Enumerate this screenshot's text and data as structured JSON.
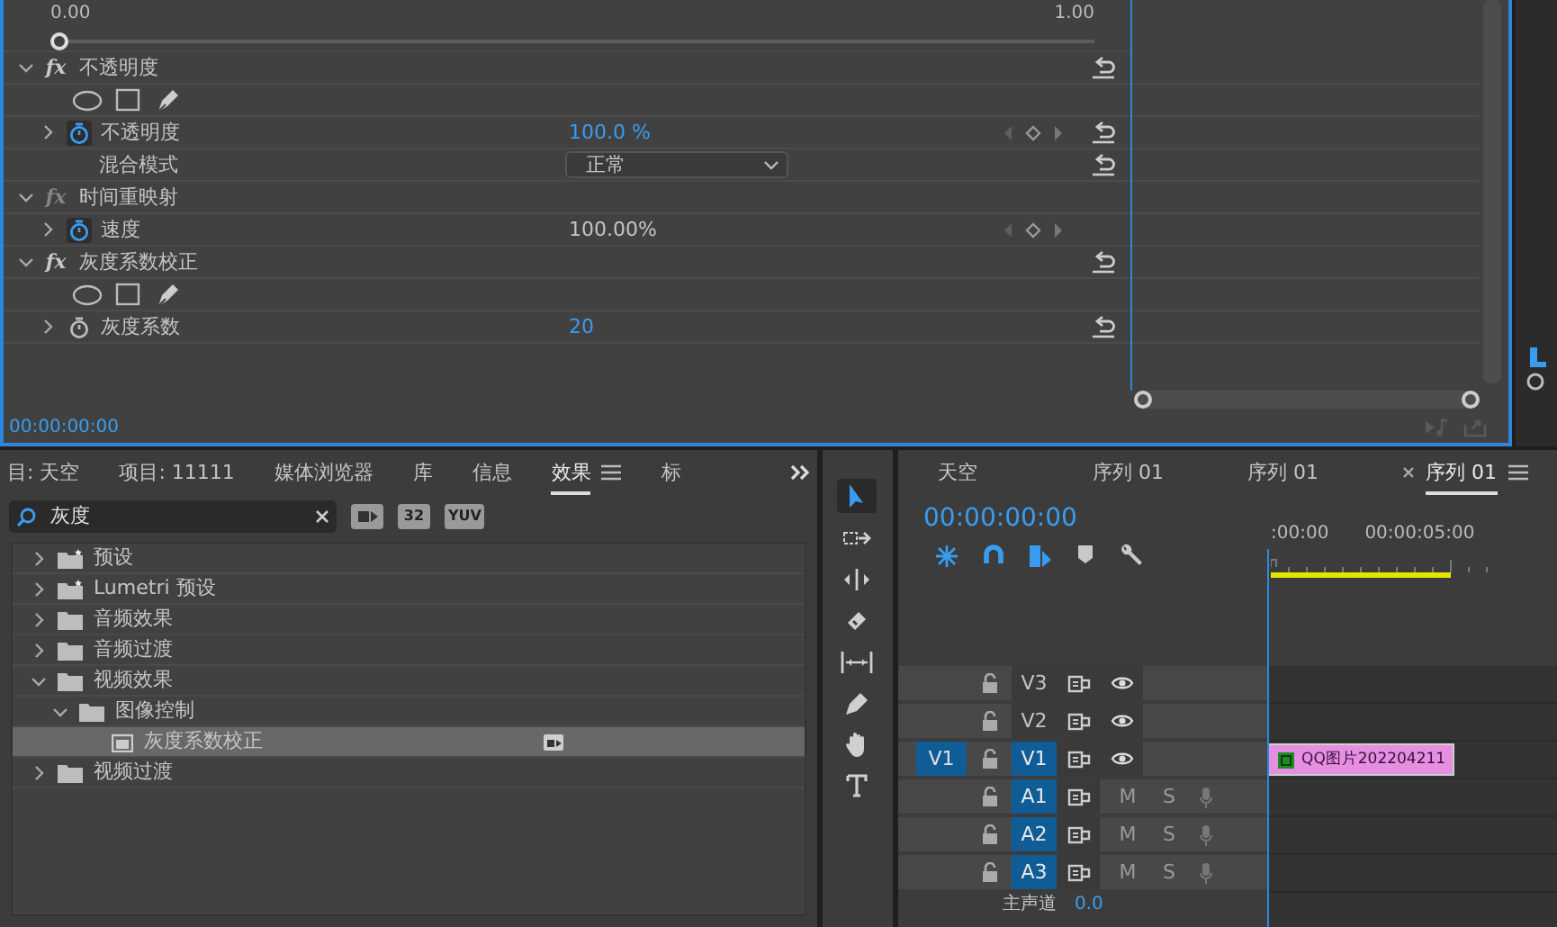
{
  "effect_controls": {
    "ruler": {
      "start": "0.00",
      "end": "1.00",
      "level": 0
    },
    "effects": [
      {
        "badge": "fx",
        "name": "不透明度",
        "expanded": true,
        "enabled": true,
        "reset": true,
        "children": [
          {
            "kind": "masks"
          },
          {
            "kind": "param",
            "name": "不透明度",
            "value": "100.0 %",
            "expanded": false,
            "animated": true,
            "scrubbable": true,
            "keyframes": true,
            "reset": true
          },
          {
            "kind": "dropdown",
            "name": "混合模式",
            "value": "正常",
            "reset": true
          }
        ]
      },
      {
        "badge": "fx",
        "name": "时间重映射",
        "expanded": true,
        "enabled": false,
        "reset": false,
        "children": [
          {
            "kind": "param",
            "name": "速度",
            "value": "100.00%",
            "expanded": false,
            "animated": true,
            "scrubbable": false,
            "keyframes": true,
            "reset": false
          }
        ]
      },
      {
        "badge": "fx",
        "name": "灰度系数校正",
        "expanded": true,
        "enabled": true,
        "reset": true,
        "children": [
          {
            "kind": "masks"
          },
          {
            "kind": "param",
            "name": "灰度系数",
            "value": "20",
            "expanded": false,
            "animated": false,
            "scrubbable": true,
            "keyframes": false,
            "reset": true
          }
        ]
      }
    ],
    "timecode": "00:00:00:00"
  },
  "effects_panel": {
    "tabs": [
      {
        "label": "目: 天空",
        "selected": false
      },
      {
        "label": "项目: 11111",
        "selected": false
      },
      {
        "label": "媒体浏览器",
        "selected": false
      },
      {
        "label": "库",
        "selected": false
      },
      {
        "label": "信息",
        "selected": false
      },
      {
        "label": "效果",
        "selected": true
      },
      {
        "label": "标",
        "selected": false
      }
    ],
    "search": {
      "value": "灰度"
    },
    "filters": [
      {
        "kind": "accelerated"
      },
      {
        "kind": "label",
        "label": "32"
      },
      {
        "kind": "label",
        "label": "YUV"
      }
    ],
    "tree": [
      {
        "kind": "preset_bin",
        "name": "预设",
        "expanded": false,
        "selected": false
      },
      {
        "kind": "preset_bin",
        "name": "Lumetri 预设",
        "expanded": false,
        "selected": false
      },
      {
        "kind": "bin",
        "name": "音频效果",
        "expanded": false,
        "selected": false
      },
      {
        "kind": "bin",
        "name": "音频过渡",
        "expanded": false,
        "selected": false
      },
      {
        "kind": "bin",
        "name": "视频效果",
        "expanded": true,
        "selected": false,
        "children": [
          {
            "kind": "bin",
            "name": "图像控制",
            "expanded": true,
            "selected": false,
            "children": [
              {
                "kind": "effect",
                "name": "灰度系数校正",
                "selected": true,
                "accelerated": true
              }
            ]
          }
        ]
      },
      {
        "kind": "bin",
        "name": "视频过渡",
        "expanded": false,
        "selected": false
      }
    ]
  },
  "tools": [
    {
      "kind": "selection",
      "selected": true
    },
    {
      "kind": "track_select",
      "selected": false
    },
    {
      "kind": "ripple",
      "selected": false
    },
    {
      "kind": "razor",
      "selected": false
    },
    {
      "kind": "slip",
      "selected": false
    },
    {
      "kind": "pen",
      "selected": false
    },
    {
      "kind": "hand",
      "selected": false
    },
    {
      "kind": "type",
      "selected": false
    }
  ],
  "timeline": {
    "tabs": [
      {
        "label": "天空",
        "selected": false,
        "closable": false
      },
      {
        "label": "序列 01",
        "selected": false,
        "closable": false
      },
      {
        "label": "序列 01",
        "selected": false,
        "closable": false
      },
      {
        "label": "序列 01",
        "selected": true,
        "closable": true
      }
    ],
    "timecode": "00:00:00:00",
    "toggles": [
      {
        "kind": "nest",
        "on": true
      },
      {
        "kind": "snap",
        "on": true
      },
      {
        "kind": "linked",
        "on": true
      },
      {
        "kind": "marker",
        "on": false
      },
      {
        "kind": "settings",
        "on": false
      }
    ],
    "ruler": [
      ":00:00",
      "00:00:05:00"
    ],
    "tracks": [
      {
        "kind": "video",
        "label": "V3",
        "targeted": false,
        "locked": false,
        "visible": true
      },
      {
        "kind": "video",
        "label": "V2",
        "targeted": false,
        "locked": false,
        "visible": true
      },
      {
        "kind": "video",
        "label": "V1",
        "source_patch": "V1",
        "targeted": true,
        "locked": false,
        "visible": true,
        "clips": [
          {
            "name": "QQ图片202204211"
          }
        ]
      },
      {
        "kind": "audio",
        "label": "A1",
        "targeted": true,
        "locked": false,
        "mute": "M",
        "solo": "S"
      },
      {
        "kind": "audio",
        "label": "A2",
        "targeted": true,
        "locked": false,
        "mute": "M",
        "solo": "S"
      },
      {
        "kind": "audio",
        "label": "A3",
        "targeted": true,
        "locked": false,
        "mute": "M",
        "solo": "S"
      }
    ],
    "master": {
      "name": "主声道",
      "value": "0.0"
    }
  }
}
